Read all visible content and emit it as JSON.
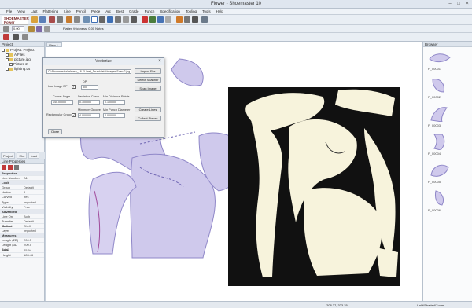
{
  "app": {
    "title": "Flower - Shoemaster 10"
  },
  "menu": [
    "File",
    "View",
    "Last",
    "Flattening",
    "Line",
    "Pencil",
    "Piece",
    "Arc",
    "Best",
    "Grade",
    "Punch",
    "Specification",
    "Tooling",
    "Tools",
    "Help"
  ],
  "toolbar": {
    "zoom_value": "0.00",
    "flatten_label": "Flatten thickness: 0.00 Notes",
    "logo_text": "SHOEMASTER Power"
  },
  "project": {
    "title": "Project",
    "items": [
      "Project: Project",
      "A Files",
      "picture.jpg",
      "Picture 2",
      "lighting.ds"
    ]
  },
  "panel_tabs": [
    "Project",
    "Elm",
    "Last"
  ],
  "line_properties": {
    "title": "Line Properties",
    "rows": [
      {
        "k": "Properties",
        "v": "",
        "section": true
      },
      {
        "k": "Line Number",
        "v": "A1"
      },
      {
        "k": "Look",
        "v": "",
        "section": true
      },
      {
        "k": "Group",
        "v": "Default"
      },
      {
        "k": "Nodes",
        "v": "9"
      },
      {
        "k": "Curved",
        "v": "Yes"
      },
      {
        "k": "Type",
        "v": "Imported"
      },
      {
        "k": "Visibility",
        "v": "Free"
      },
      {
        "k": "Advanced",
        "v": "",
        "section": true
      },
      {
        "k": "Line On",
        "v": "Both"
      },
      {
        "k": "Transfer Method",
        "v": "Default"
      },
      {
        "k": "Surface",
        "v": "Shell"
      },
      {
        "k": "Layer",
        "v": "Imported"
      },
      {
        "k": "Measures",
        "v": "",
        "section": true
      },
      {
        "k": "Length (2D)",
        "v": "200.5"
      },
      {
        "k": "Length (3D Total)",
        "v": "200.5"
      },
      {
        "k": "Width",
        "v": "45.94"
      },
      {
        "k": "Height",
        "v": "183.46"
      }
    ]
  },
  "canvas": {
    "tab_label": "View 1"
  },
  "dialog": {
    "title": "Vectorize",
    "file_path": "C:\\Shoemaster\\release_16 FL\\test_Drum\\data\\Images\\Scan 2.jpg",
    "import_file": "Import File",
    "select_scanner": "Select Scanner",
    "scan_image": "Scan Image",
    "use_image_dpi_label": "Use Image DPI",
    "dpi_label": "DPI",
    "dpi_value": "300",
    "corner_angle_label": "Corner Angle",
    "corner_angle_value": "140.00000",
    "deviation_curve_label": "Deviation Curve",
    "deviation_curve_value": "0.100000",
    "min_distance_label": "Min Distance Points",
    "min_distance_value": "0.100000",
    "rectangular_label": "Rectangular Grooves",
    "minimum_groove_label": "Minimum Groove",
    "minimum_groove_value": "4.000000",
    "min_punch_label": "Min Punch Diameter",
    "min_punch_value": "4.000000",
    "create_lines": "Create Lines",
    "collect_pieces": "Collect Pieces",
    "close": "Close"
  },
  "browser": {
    "title": "Browser",
    "items": [
      "P_00001",
      "P_00002",
      "P_00003",
      "P_00004",
      "P_00005",
      "P_00006"
    ]
  },
  "status": {
    "coords": "208.37, 323.25",
    "mode": "Unlit/Shaded/Zoom"
  },
  "colors": {
    "piece_fill": "#cfc9ec",
    "piece_stroke": "#8f87c8",
    "scan_bg": "#111111",
    "scan_piece": "#f7f3dc",
    "accent": "#3d6fb5"
  }
}
